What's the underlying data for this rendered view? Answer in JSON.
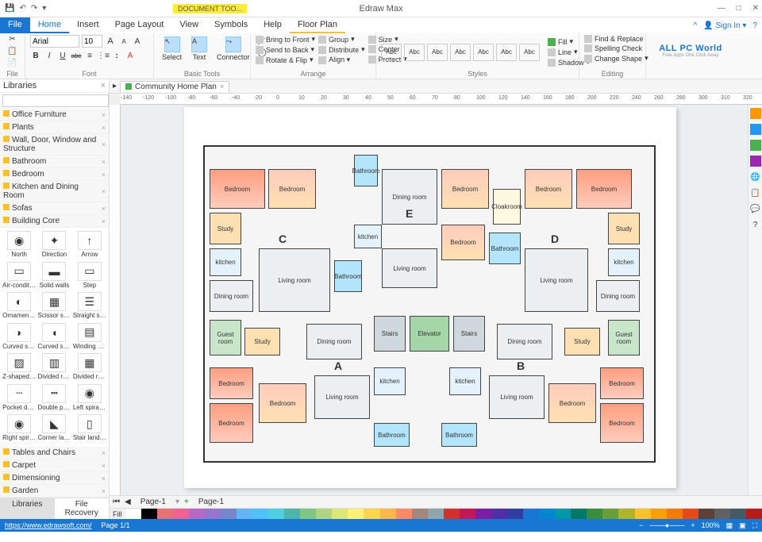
{
  "app": {
    "title": "Edraw Max",
    "doc_tools": "DOCUMENT TOO..."
  },
  "window_controls": {
    "min": "—",
    "max": "□",
    "close": "✕"
  },
  "menubar": {
    "tabs": [
      "File",
      "Home",
      "Insert",
      "Page Layout",
      "View",
      "Symbols",
      "Help"
    ],
    "context_tab": "Floor Plan",
    "signin": "Sign In",
    "help": "?"
  },
  "ribbon": {
    "file": {
      "label": "File"
    },
    "font": {
      "label": "Font",
      "family": "Arial",
      "size": "10",
      "increase": "A",
      "decrease": "A",
      "bold": "B",
      "italic": "I",
      "underline": "U",
      "strike": "abc"
    },
    "basic_tools": {
      "label": "Basic Tools",
      "select": "Select",
      "text": "Text",
      "connector": "Connector"
    },
    "arrange": {
      "label": "Arrange",
      "bring_front": "Bring to Front",
      "send_back": "Send to Back",
      "rotate": "Rotate & Flip",
      "group": "Group",
      "distribute": "Distribute",
      "size": "Size",
      "center": "Center",
      "protect": "Protect"
    },
    "align_col": {
      "size": "Size",
      "center": "Center",
      "protect": "Protect"
    },
    "styles": {
      "label": "Styles",
      "box": "Abc",
      "fill": "Fill",
      "line": "Line",
      "shadow": "Shadow"
    },
    "editing": {
      "label": "Editing",
      "find": "Find & Replace",
      "spell": "Spelling Check",
      "change": "Change Shape"
    },
    "logo": {
      "line1": "ALL PC World",
      "line2": "Free Apps One Click Away"
    }
  },
  "libraries": {
    "title": "Libraries",
    "categories": [
      "Office Furniture",
      "Plants",
      "Wall, Door, Window and Structure",
      "Bathroom",
      "Bedroom",
      "Kitchen and Dining Room",
      "Sofas",
      "Building Core"
    ],
    "categories2": [
      "Tables and Chairs",
      "Carpet",
      "Dimensioning",
      "Garden"
    ],
    "shapes": [
      {
        "n": "North",
        "g": "◉"
      },
      {
        "n": "Direction",
        "g": "✦"
      },
      {
        "n": "Arrow",
        "g": "↑"
      },
      {
        "n": "Air-conditi...",
        "g": "▭"
      },
      {
        "n": "Solid walls",
        "g": "▬"
      },
      {
        "n": "Step",
        "g": "▭"
      },
      {
        "n": "Ornament...",
        "g": "◐"
      },
      {
        "n": "Scissor stai...",
        "g": "▦"
      },
      {
        "n": "Straight sta...",
        "g": "☰"
      },
      {
        "n": "Curved stai...",
        "g": "◗"
      },
      {
        "n": "Curved stai...",
        "g": "◖"
      },
      {
        "n": "Winding st...",
        "g": "▤"
      },
      {
        "n": "Z-shaped s...",
        "g": "▨"
      },
      {
        "n": "Divided ret...",
        "g": "▥"
      },
      {
        "n": "Divided ret...",
        "g": "▦"
      },
      {
        "n": "Pocket door",
        "g": "┄"
      },
      {
        "n": "Double po...",
        "g": "┅"
      },
      {
        "n": "Left spiral s...",
        "g": "◉"
      },
      {
        "n": "Right spiral...",
        "g": "◉"
      },
      {
        "n": "Corner lan...",
        "g": "◣"
      },
      {
        "n": "Stair landing",
        "g": "▯"
      }
    ],
    "tabs": {
      "lib": "Libraries",
      "recovery": "File Recovery"
    }
  },
  "document": {
    "tab": "Community Home Plan"
  },
  "ruler": {
    "marks": [
      -140,
      -120,
      -100,
      -80,
      -60,
      -40,
      -20,
      0,
      10,
      20,
      30,
      40,
      50,
      60,
      70,
      80,
      100,
      120,
      140,
      160,
      180,
      200,
      220,
      240,
      260,
      280,
      300,
      310,
      320
    ]
  },
  "floorplan": {
    "units": {
      "A": "A",
      "B": "B",
      "C": "C",
      "D": "D",
      "E": "E"
    },
    "rooms": {
      "bedroom": "Bedroom",
      "study": "Study",
      "dining": "Dining room",
      "living": "Living room",
      "kitchen": "kitchen",
      "bathroom": "Bathroom",
      "guest": "Guest room",
      "cloak": "Cloakroom",
      "stairs": "Stairs",
      "elevator": "Elevator"
    }
  },
  "pagebar": {
    "page": "Page-1",
    "page2": "Page-1",
    "plus": "+"
  },
  "colorbar": {
    "label": "Fill"
  },
  "status": {
    "url": "https://www.edrawsoft.com/",
    "page": "Page 1/1",
    "zoom": "100%"
  }
}
